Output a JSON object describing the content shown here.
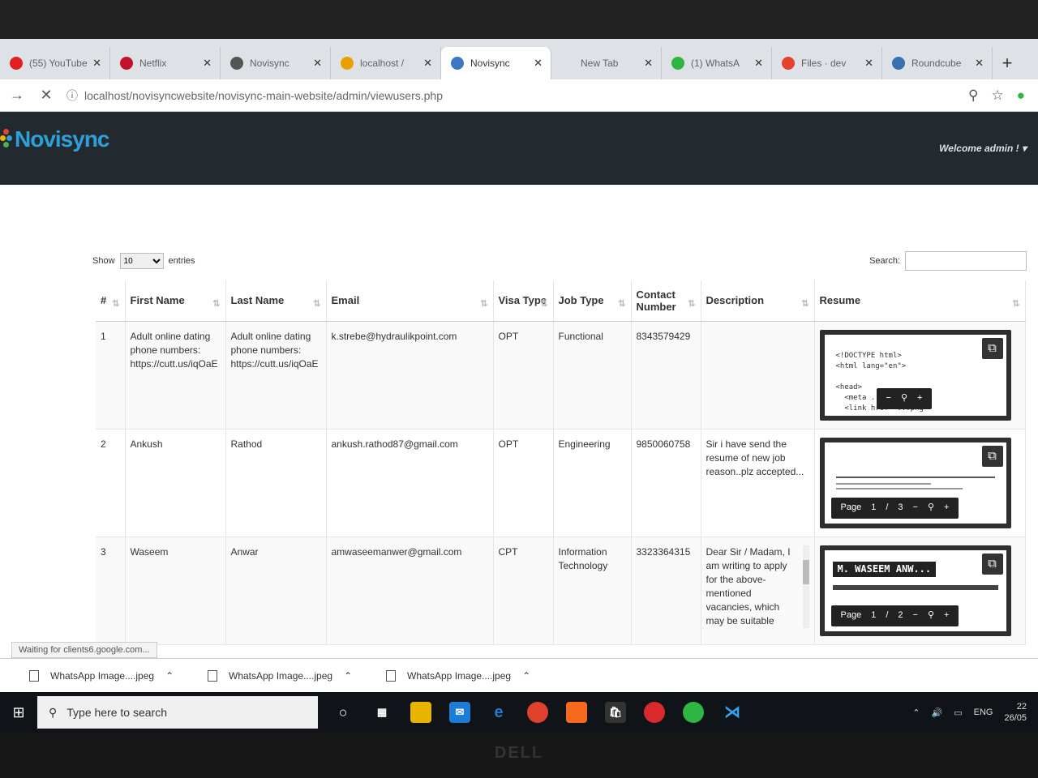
{
  "browser": {
    "tabs": [
      {
        "title": "(55) YouTube",
        "fav_color": "#e02020"
      },
      {
        "title": "Netflix",
        "fav_color": "#c0122a"
      },
      {
        "title": "Novisync",
        "fav_color": "#555555"
      },
      {
        "title": "localhost /",
        "fav_color": "#e8a000"
      },
      {
        "title": "Novisync",
        "fav_color": "#3b78c2",
        "active": true
      },
      {
        "title": "New Tab",
        "fav_color": "#dee1e6"
      },
      {
        "title": "(1) WhatsA",
        "fav_color": "#2db742"
      },
      {
        "title": "Files · dev",
        "fav_color": "#e2432a"
      },
      {
        "title": "Roundcube",
        "fav_color": "#3a6fb0"
      }
    ],
    "url": "localhost/novisyncwebsite/novisync-main-website/admin/viewusers.php"
  },
  "site": {
    "logo": "Novisync",
    "welcome": "Welcome admin ! ▾"
  },
  "table_controls": {
    "show_label": "Show",
    "length_value": "10",
    "entries_label": "entries",
    "search_label": "Search:"
  },
  "columns": [
    "#",
    "First Name",
    "Last Name",
    "Email",
    "Visa Type",
    "Job Type",
    "Contact Number",
    "Description",
    "Resume"
  ],
  "rows": [
    {
      "num": "1",
      "first": "Adult online dating phone numbers: https://cutt.us/iqOaE",
      "last": "Adult online dating phone numbers: https://cutt.us/iqOaE",
      "email": "k.strebe@hydraulikpoint.com",
      "visa": "OPT",
      "job": "Functional",
      "contact": "8343579429",
      "desc": ""
    },
    {
      "num": "2",
      "first": "Ankush",
      "last": "Rathod",
      "email": "ankush.rathod87@gmail.com",
      "visa": "OPT",
      "job": "Engineering",
      "contact": "9850060758",
      "desc": "Sir i have send the resume of new job reason..plz accepted..."
    },
    {
      "num": "3",
      "first": "Waseem",
      "last": "Anwar",
      "email": "amwaseemanwer@gmail.com",
      "visa": "CPT",
      "job": "Information Technology",
      "contact": "3323364315",
      "desc": "Dear Sir / Madam, I am writing to apply for the above-mentioned vacancies, which may be suitable"
    }
  ],
  "previews": {
    "r1_code": "<!DOCTYPE html>\n<html lang=\"en\">\n\n<head>\n  <meta ...\">\n  <link href=\"...png\"",
    "r2_page": "Page",
    "r2_current": "1",
    "r2_sep": "/",
    "r2_total": "3",
    "r3_page": "Page",
    "r3_current": "1",
    "r3_sep": "/",
    "r3_total": "2",
    "r3_heading": "M. WASEEM ANW..."
  },
  "status_text": "Waiting for clients6.google.com...",
  "downloads": [
    "WhatsApp Image....jpeg",
    "WhatsApp Image....jpeg",
    "WhatsApp Image....jpeg"
  ],
  "taskbar": {
    "search_placeholder": "Type here to search",
    "lang": "ENG",
    "time": "22",
    "date": "26/05"
  },
  "monitor_brand": "DELL"
}
